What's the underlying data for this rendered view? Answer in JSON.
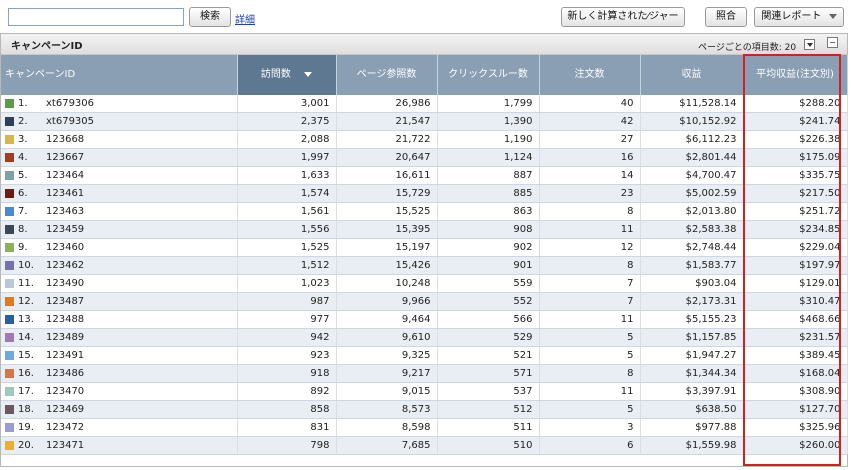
{
  "toolbar": {
    "search_value": "",
    "search_button": "検索",
    "detail_link": "詳細",
    "new_metric_button": "新しく計算された⁄ジャー",
    "compare_button": "照合",
    "related_reports_button": "関連レポート",
    "dropdown_icon": "chevron-down-icon"
  },
  "panel": {
    "title": "キャンペーンID",
    "per_page_label": "ページごとの項目数: 20",
    "collapse_icon": "minus-icon"
  },
  "table": {
    "headers": [
      "キャンペーンID",
      "訪問数",
      "ページ参照数",
      "クリックスルー数",
      "注文数",
      "収益",
      "平均収益(注文別)"
    ],
    "sort_icon": "sort-desc-icon",
    "rows": [
      {
        "rank": "1.",
        "color": "#5a9a4a",
        "id": "xt679306",
        "visits": "3,001",
        "pageviews": "26,986",
        "clicks": "1,799",
        "orders": "40",
        "revenue": "$11,528.14",
        "avg": "$288.20"
      },
      {
        "rank": "2.",
        "color": "#2e3f57",
        "id": "xt679305",
        "visits": "2,375",
        "pageviews": "21,547",
        "clicks": "1,390",
        "orders": "42",
        "revenue": "$10,152.92",
        "avg": "$241.74"
      },
      {
        "rank": "3.",
        "color": "#d6b74a",
        "id": "123668",
        "visits": "2,088",
        "pageviews": "21,722",
        "clicks": "1,190",
        "orders": "27",
        "revenue": "$6,112.23",
        "avg": "$226.38"
      },
      {
        "rank": "4.",
        "color": "#a53a1f",
        "id": "123667",
        "visits": "1,997",
        "pageviews": "20,647",
        "clicks": "1,124",
        "orders": "16",
        "revenue": "$2,801.44",
        "avg": "$175.09"
      },
      {
        "rank": "5.",
        "color": "#7aa3a8",
        "id": "123464",
        "visits": "1,633",
        "pageviews": "16,611",
        "clicks": "887",
        "orders": "14",
        "revenue": "$4,700.47",
        "avg": "$335.75"
      },
      {
        "rank": "6.",
        "color": "#6b1d14",
        "id": "123461",
        "visits": "1,574",
        "pageviews": "15,729",
        "clicks": "885",
        "orders": "23",
        "revenue": "$5,002.59",
        "avg": "$217.50"
      },
      {
        "rank": "7.",
        "color": "#4a8ad0",
        "id": "123463",
        "visits": "1,561",
        "pageviews": "15,525",
        "clicks": "863",
        "orders": "8",
        "revenue": "$2,013.80",
        "avg": "$251.72"
      },
      {
        "rank": "8.",
        "color": "#3a4a55",
        "id": "123459",
        "visits": "1,556",
        "pageviews": "15,395",
        "clicks": "908",
        "orders": "11",
        "revenue": "$2,583.38",
        "avg": "$234.85"
      },
      {
        "rank": "9.",
        "color": "#8db05a",
        "id": "123460",
        "visits": "1,525",
        "pageviews": "15,197",
        "clicks": "902",
        "orders": "12",
        "revenue": "$2,748.44",
        "avg": "$229.04"
      },
      {
        "rank": "10.",
        "color": "#7670b0",
        "id": "123462",
        "visits": "1,512",
        "pageviews": "15,426",
        "clicks": "901",
        "orders": "8",
        "revenue": "$1,583.77",
        "avg": "$197.97"
      },
      {
        "rank": "11.",
        "color": "#b8c8d8",
        "id": "123490",
        "visits": "1,023",
        "pageviews": "10,248",
        "clicks": "559",
        "orders": "7",
        "revenue": "$903.04",
        "avg": "$129.01"
      },
      {
        "rank": "12.",
        "color": "#e07a20",
        "id": "123487",
        "visits": "987",
        "pageviews": "9,966",
        "clicks": "552",
        "orders": "7",
        "revenue": "$2,173.31",
        "avg": "$310.47"
      },
      {
        "rank": "13.",
        "color": "#2a5f9a",
        "id": "123488",
        "visits": "977",
        "pageviews": "9,464",
        "clicks": "566",
        "orders": "11",
        "revenue": "$5,155.23",
        "avg": "$468.66"
      },
      {
        "rank": "14.",
        "color": "#a07ab0",
        "id": "123489",
        "visits": "942",
        "pageviews": "9,610",
        "clicks": "529",
        "orders": "5",
        "revenue": "$1,157.85",
        "avg": "$231.57"
      },
      {
        "rank": "15.",
        "color": "#6fa8e0",
        "id": "123491",
        "visits": "923",
        "pageviews": "9,325",
        "clicks": "521",
        "orders": "5",
        "revenue": "$1,947.27",
        "avg": "$389.45"
      },
      {
        "rank": "16.",
        "color": "#d0784a",
        "id": "123486",
        "visits": "918",
        "pageviews": "9,217",
        "clicks": "571",
        "orders": "8",
        "revenue": "$1,344.34",
        "avg": "$168.04"
      },
      {
        "rank": "17.",
        "color": "#9ec9c0",
        "id": "123470",
        "visits": "892",
        "pageviews": "9,015",
        "clicks": "537",
        "orders": "11",
        "revenue": "$3,397.91",
        "avg": "$308.90"
      },
      {
        "rank": "18.",
        "color": "#6a5a60",
        "id": "123469",
        "visits": "858",
        "pageviews": "8,573",
        "clicks": "512",
        "orders": "5",
        "revenue": "$638.50",
        "avg": "$127.70"
      },
      {
        "rank": "19.",
        "color": "#9a9ad8",
        "id": "123472",
        "visits": "831",
        "pageviews": "8,598",
        "clicks": "511",
        "orders": "3",
        "revenue": "$977.88",
        "avg": "$325.96"
      },
      {
        "rank": "20.",
        "color": "#e8b030",
        "id": "123471",
        "visits": "798",
        "pageviews": "7,685",
        "clicks": "510",
        "orders": "6",
        "revenue": "$1,559.98",
        "avg": "$260.00"
      }
    ]
  },
  "colors": {
    "header_bg": "#8a9eb4",
    "sorted_header_bg": "#5f7892",
    "highlight_border": "#d42020"
  }
}
